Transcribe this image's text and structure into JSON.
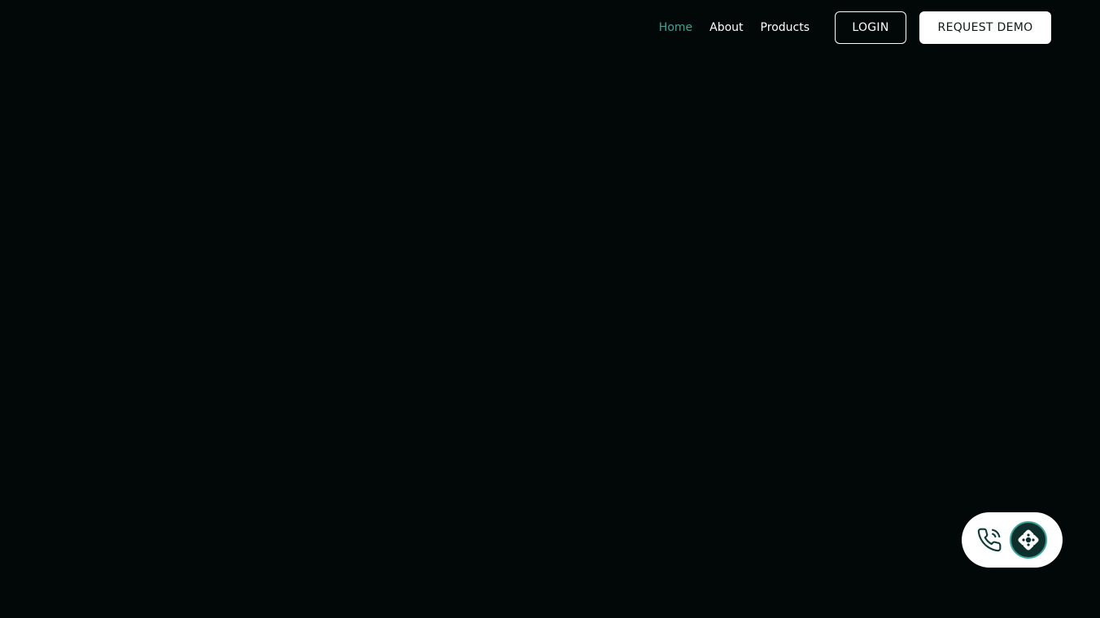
{
  "nav": {
    "links": [
      {
        "label": "Home",
        "active": true
      },
      {
        "label": "About",
        "active": false
      },
      {
        "label": "Products",
        "active": false
      }
    ],
    "login_label": "LOGIN",
    "demo_label": "REQUEST DEMO"
  },
  "contact_widget": {
    "phone_icon": "phone-icon",
    "brand_icon": "brand-logo-icon"
  },
  "colors": {
    "background": "#020808",
    "accent": "#3aa596",
    "text": "#ffffff",
    "brand_dark": "#0f2f2c"
  }
}
